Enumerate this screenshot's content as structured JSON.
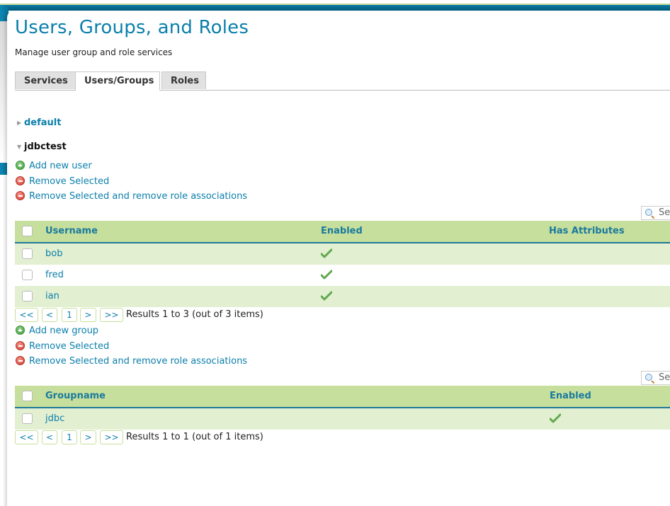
{
  "header": {
    "title": "Users, Groups, and Roles",
    "subtitle": "Manage user group and role services"
  },
  "tabs": [
    {
      "label": "Services",
      "active": false
    },
    {
      "label": "Users/Groups",
      "active": true
    },
    {
      "label": "Roles",
      "active": false
    }
  ],
  "services": [
    {
      "name": "default",
      "expanded": false
    },
    {
      "name": "jdbctest",
      "expanded": true
    }
  ],
  "users_section": {
    "actions": {
      "add": "Add new user",
      "remove": "Remove Selected",
      "remove_roles": "Remove Selected and remove role associations"
    },
    "search_placeholder": "Search",
    "columns": [
      "Username",
      "Enabled",
      "Has Attributes"
    ],
    "rows": [
      {
        "username": "bob",
        "enabled": true,
        "has_attributes": false
      },
      {
        "username": "fred",
        "enabled": true,
        "has_attributes": false
      },
      {
        "username": "ian",
        "enabled": true,
        "has_attributes": false
      }
    ],
    "pager": {
      "first": "<<",
      "prev": "<",
      "page": "1",
      "next": ">",
      "last": ">>",
      "results": "Results 1 to 3 (out of 3 items)"
    }
  },
  "groups_section": {
    "actions": {
      "add": "Add new group",
      "remove": "Remove Selected",
      "remove_roles": "Remove Selected and remove role associations"
    },
    "search_placeholder": "Search",
    "columns": [
      "Groupname",
      "Enabled"
    ],
    "rows": [
      {
        "groupname": "jdbc",
        "enabled": true
      }
    ],
    "pager": {
      "first": "<<",
      "prev": "<",
      "page": "1",
      "next": ">",
      "last": ">>",
      "results": "Results 1 to 1 (out of 1 items)"
    }
  },
  "icons": {
    "add": "plus-circle-green",
    "remove": "minus-circle-red",
    "enabled": "green-checkmark",
    "search": "magnifier",
    "collapsed": "triangle-right",
    "expanded": "triangle-down"
  },
  "colors": {
    "accent": "#0b7fab",
    "header_band": "#005a7c",
    "grid_header": "#c7df9c",
    "grid_row_alt": "#e2efd1",
    "add_icon": "#3d9e3a",
    "remove_icon": "#d2392c"
  }
}
